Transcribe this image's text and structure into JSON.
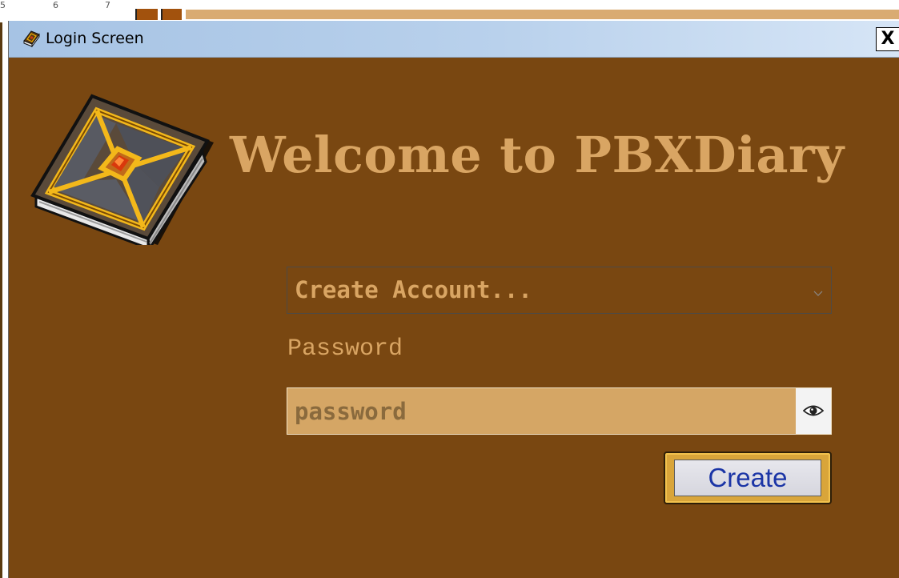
{
  "background": {
    "ruler_numbers": [
      "5",
      "6",
      "7"
    ]
  },
  "window": {
    "title": "Login Screen",
    "title_icon": "book-icon",
    "close_label": "X"
  },
  "header": {
    "welcome": "Welcome to PBXDiary",
    "logo_icon": "book-logo-icon"
  },
  "form": {
    "account_select": {
      "selected": "Create Account...",
      "icon": "chevron-down-icon"
    },
    "password_label": "Password",
    "password_input": {
      "value": "",
      "placeholder": "password"
    },
    "reveal_icon": "eye-icon",
    "create_label": "Create"
  },
  "colors": {
    "window_bg": "#794711",
    "accent_text": "#d9a563",
    "input_bg": "#d5a665",
    "button_frame": "#d9a53a",
    "button_text": "#1b35a6"
  }
}
